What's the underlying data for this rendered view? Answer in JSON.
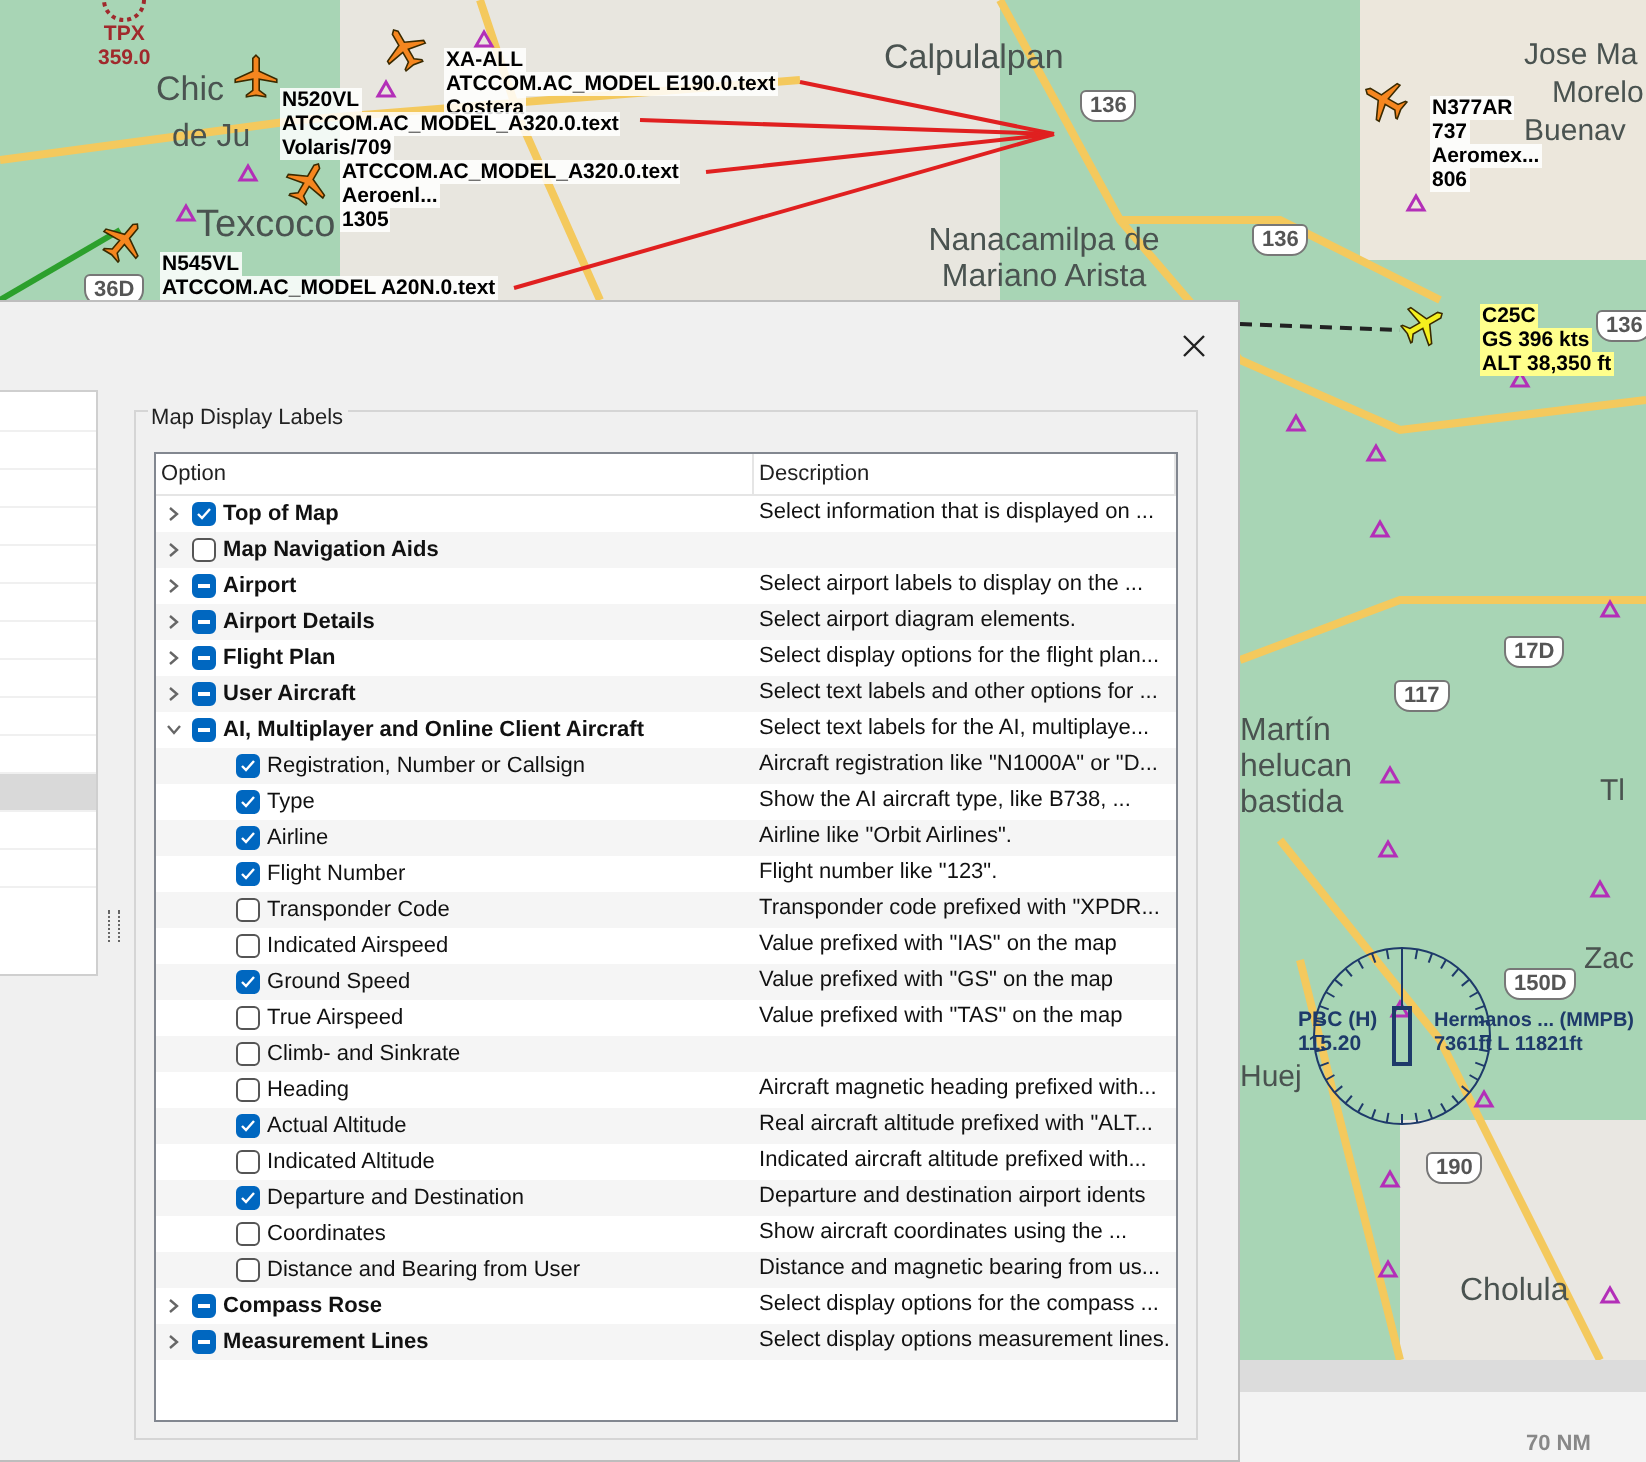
{
  "map": {
    "places": [
      "Calpulalpan",
      "Texcoco",
      "Nanacamilpa de Mariano Arista",
      "Jose Ma",
      "Morelo",
      "Buenav",
      "Martín",
      "helucan",
      "bastida",
      "Tl",
      "Zac",
      "Cholula",
      "Huej",
      "Chic",
      "de Ju"
    ],
    "shields": [
      "136",
      "136",
      "136",
      "117",
      "17D",
      "150D",
      "190",
      "36D"
    ],
    "navaid": {
      "lines": [
        "TPX",
        "359.0"
      ]
    },
    "aircraft": [
      {
        "kind": "ai",
        "lines": [
          "XA-ALL",
          "ATCCOM.AC_MODEL E190.0.text",
          "Costera"
        ]
      },
      {
        "kind": "ai",
        "lines": [
          "N520VL",
          "ATCCOM.AC_MODEL_A320.0.text",
          "Volaris/709"
        ]
      },
      {
        "kind": "ai",
        "lines": [
          "ATCCOM.AC_MODEL_A320.0.text",
          "Aeroenl...",
          "1305"
        ]
      },
      {
        "kind": "ai",
        "lines": [
          "N545VL",
          "ATCCOM.AC_MODEL A20N.0.text"
        ]
      },
      {
        "kind": "ai",
        "lines": [
          "N377AR",
          "737",
          "Aeromex...",
          "806"
        ]
      },
      {
        "kind": "user",
        "lines": [
          "C25C",
          "GS 396 kts",
          "ALT 38,350 ft"
        ]
      }
    ],
    "vor": {
      "lines": [
        "PBC (H)",
        "115.20"
      ]
    },
    "airport": {
      "lines": [
        "Hermanos ... (MMPB)",
        "7361ft L 11821ft"
      ]
    },
    "scale": "70 NM"
  },
  "dialog": {
    "side_list": [
      {
        "selected": false
      },
      {
        "selected": false
      },
      {
        "selected": false
      },
      {
        "selected": false
      },
      {
        "selected": false
      },
      {
        "selected": false
      },
      {
        "selected": false
      },
      {
        "selected": false
      },
      {
        "selected": false
      },
      {
        "selected": false
      },
      {
        "selected": true
      },
      {
        "selected": false
      },
      {
        "selected": false
      }
    ],
    "group_title": "Map Display Labels",
    "columns": [
      "Option",
      "Description"
    ],
    "items": [
      {
        "label": "Top of Map",
        "description": "Select information that is displayed on ...",
        "checked": true,
        "partial": false,
        "expanded": false
      },
      {
        "label": "Map Navigation Aids",
        "checked": false,
        "partial": false,
        "expanded": false
      },
      {
        "label": "Airport",
        "description": "Select airport labels to display on the ...",
        "checked": true,
        "partial": true,
        "expanded": false
      },
      {
        "label": "Airport Details",
        "description": "Select airport diagram elements.",
        "checked": true,
        "partial": true,
        "expanded": false
      },
      {
        "label": "Flight Plan",
        "description": "Select display options for the flight plan...",
        "checked": true,
        "partial": true,
        "expanded": false
      },
      {
        "label": "User Aircraft",
        "description": "Select text labels and other options for ...",
        "checked": true,
        "partial": true,
        "expanded": false
      },
      {
        "label": "AI, Multiplayer and Online Client Aircraft",
        "description": "Select text labels for the AI, multiplaye...",
        "checked": true,
        "partial": true,
        "expanded": true,
        "children": [
          {
            "label": "Registration, Number or Callsign",
            "description": "Aircraft registration like \"N1000A\" or \"D...",
            "checked": true,
            "partial": false
          },
          {
            "label": "Type",
            "description": "Show the AI aircraft type, like B738, ...",
            "checked": true,
            "partial": false
          },
          {
            "label": "Airline",
            "description": "Airline like \"Orbit Airlines\".",
            "checked": true,
            "partial": false
          },
          {
            "label": "Flight Number",
            "description": "Flight number like \"123\".",
            "checked": true,
            "partial": false
          },
          {
            "label": "Transponder Code",
            "description": "Transponder code prefixed with \"XPDR...",
            "checked": false,
            "partial": false
          },
          {
            "label": "Indicated Airspeed",
            "description": "Value prefixed with \"IAS\" on the map",
            "checked": false,
            "partial": false
          },
          {
            "label": "Ground Speed",
            "description": "Value prefixed with \"GS\" on the map",
            "checked": true,
            "partial": false
          },
          {
            "label": "True Airspeed",
            "description": "Value prefixed with \"TAS\" on the map",
            "checked": false,
            "partial": false
          },
          {
            "label": "Climb- and Sinkrate",
            "checked": false,
            "partial": false
          },
          {
            "label": "Heading",
            "description": "Aircraft magnetic heading prefixed with...",
            "checked": false,
            "partial": false
          },
          {
            "label": "Actual Altitude",
            "description": "Real aircraft altitude prefixed with \"ALT...",
            "checked": true,
            "partial": false
          },
          {
            "label": "Indicated Altitude",
            "description": "Indicated aircraft altitude prefixed with...",
            "checked": false,
            "partial": false
          },
          {
            "label": "Departure and Destination",
            "description": "Departure and destination airport idents",
            "checked": true,
            "partial": false
          },
          {
            "label": "Coordinates",
            "description": "Show aircraft coordinates using the ...",
            "checked": false,
            "partial": false
          },
          {
            "label": "Distance and Bearing from User",
            "description": "Distance and magnetic bearing from us...",
            "checked": false,
            "partial": false
          }
        ]
      },
      {
        "label": "Compass Rose",
        "description": "Select display options for the compass ...",
        "checked": true,
        "partial": true,
        "expanded": false
      },
      {
        "label": "Measurement Lines",
        "description": "Select display options measurement lines.",
        "checked": true,
        "partial": true,
        "expanded": false
      }
    ]
  }
}
